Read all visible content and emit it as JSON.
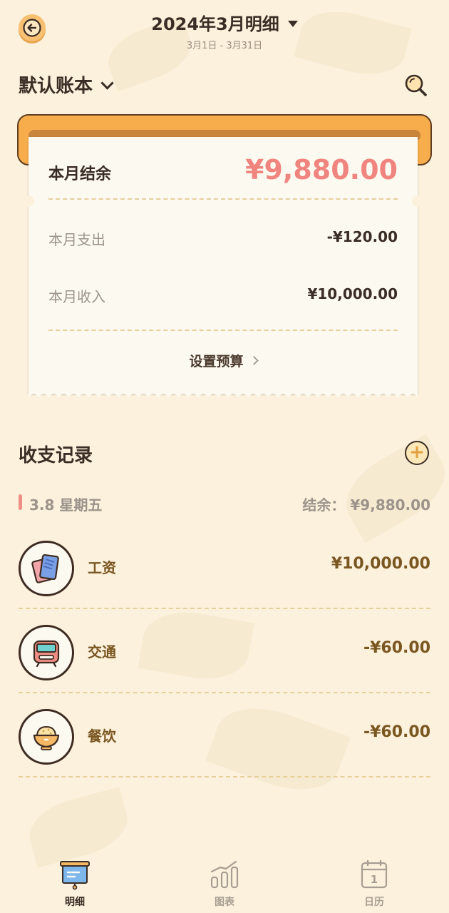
{
  "header": {
    "title": "2024年3月明细",
    "subtitle": "3月1日 - 3月31日"
  },
  "book": {
    "name": "默认账本"
  },
  "summary": {
    "balance_label": "本月结余",
    "balance_value": "¥9,880.00",
    "expense_label": "本月支出",
    "expense_value": "-¥120.00",
    "income_label": "本月收入",
    "income_value": "¥10,000.00",
    "budget_link": "设置预算"
  },
  "records": {
    "title": "收支记录",
    "add_symbol": "+",
    "day": {
      "date": "3.8 星期五",
      "balance": "结余： ¥9,880.00"
    },
    "items": [
      {
        "name": "工资",
        "amount": "¥10,000.00",
        "icon": "card-icon"
      },
      {
        "name": "交通",
        "amount": "-¥60.00",
        "icon": "train-icon"
      },
      {
        "name": "餐饮",
        "amount": "-¥60.00",
        "icon": "rice-bowl-icon"
      }
    ]
  },
  "tabs": [
    {
      "label": "明细",
      "icon": "board-icon",
      "active": true
    },
    {
      "label": "图表",
      "icon": "chart-icon",
      "active": false
    },
    {
      "label": "日历",
      "icon": "calendar-icon",
      "active": false
    }
  ],
  "colors": {
    "background": "#fbf1dc",
    "accent_orange": "#f8ad4c",
    "balance_pink": "#f0857f",
    "amount_brown": "#7a5621",
    "tab_active": "#3a2d25",
    "tab_inactive": "#a79e93"
  }
}
